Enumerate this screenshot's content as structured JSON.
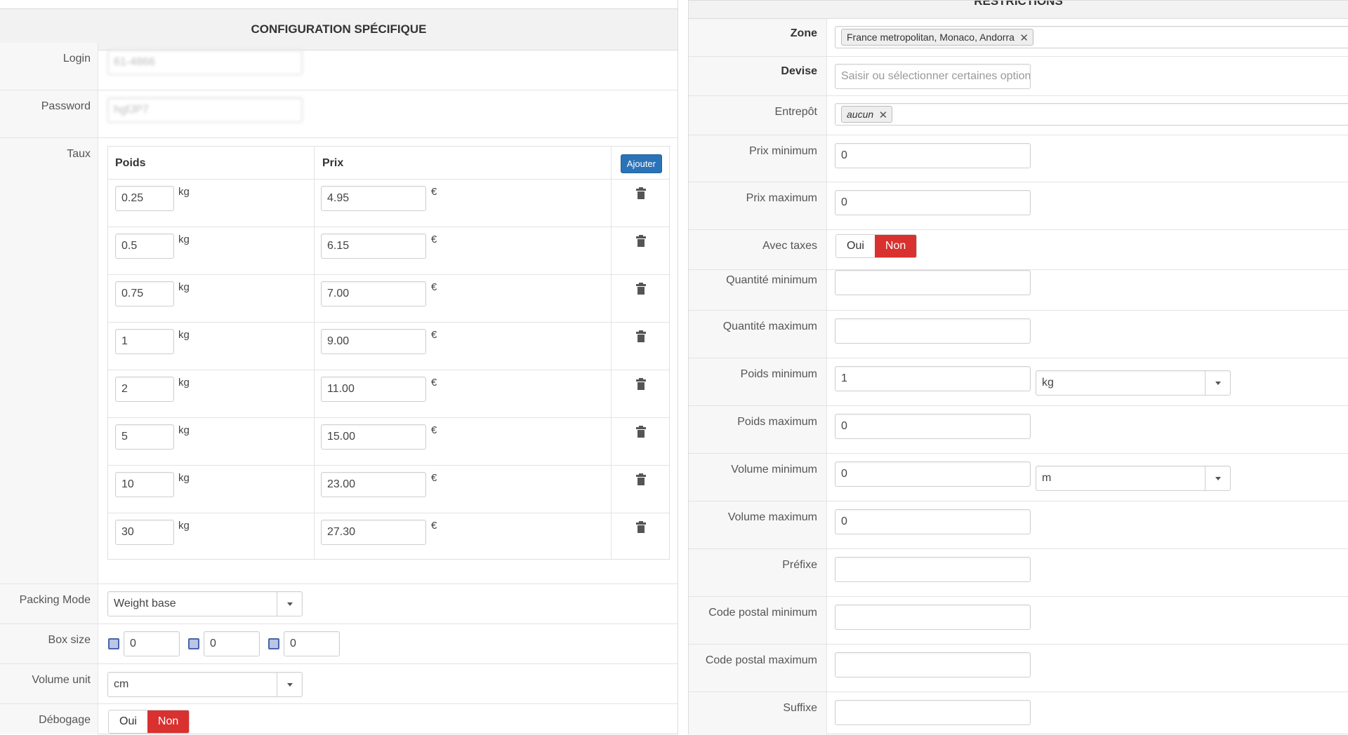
{
  "left": {
    "title": "CONFIGURATION SPÉCIFIQUE",
    "login_label": "Login",
    "login_value": "61-4866",
    "password_label": "Password",
    "password_value": "hgfJP7",
    "rates_label": "Taux",
    "col_weight": "Poids",
    "col_price": "Prix",
    "add_label": "Ajouter",
    "weight_unit": "kg",
    "currency": "€",
    "rates": [
      {
        "weight": "0.25",
        "price": "4.95"
      },
      {
        "weight": "0.5",
        "price": "6.15"
      },
      {
        "weight": "0.75",
        "price": "7.00"
      },
      {
        "weight": "1",
        "price": "9.00"
      },
      {
        "weight": "2",
        "price": "11.00"
      },
      {
        "weight": "5",
        "price": "15.00"
      },
      {
        "weight": "10",
        "price": "23.00"
      },
      {
        "weight": "30",
        "price": "27.30"
      }
    ],
    "packing_label": "Packing Mode",
    "packing_value": "Weight base",
    "box_label": "Box size",
    "box_values": [
      "0",
      "0",
      "0"
    ],
    "volume_unit_label": "Volume unit",
    "volume_unit_value": "cm",
    "debug_label": "Débogage",
    "yes": "Oui",
    "no": "Non"
  },
  "right": {
    "title": "RESTRICTIONS",
    "zone_label": "Zone",
    "zone_tag": "France metropolitan, Monaco, Andorra",
    "currency_label": "Devise",
    "currency_placeholder": "Saisir ou sélectionner certaines options",
    "warehouse_label": "Entrepôt",
    "warehouse_tag": "aucun",
    "min_price_label": "Prix minimum",
    "min_price": "0",
    "max_price_label": "Prix maximum",
    "max_price": "0",
    "taxes_label": "Avec taxes",
    "yes": "Oui",
    "no": "Non",
    "min_qty_label": "Quantité minimum",
    "max_qty_label": "Quantité maximum",
    "min_weight_label": "Poids minimum",
    "min_weight": "1",
    "weight_unit": "kg",
    "max_weight_label": "Poids maximum",
    "max_weight": "0",
    "min_volume_label": "Volume minimum",
    "min_volume": "0",
    "volume_unit": "m",
    "max_volume_label": "Volume maximum",
    "max_volume": "0",
    "prefix_label": "Préfixe",
    "min_zip_label": "Code postal minimum",
    "max_zip_label": "Code postal maximum",
    "suffix_label": "Suffixe"
  },
  "colors": {
    "accent": "#2a73b8",
    "danger": "#d9312f"
  }
}
